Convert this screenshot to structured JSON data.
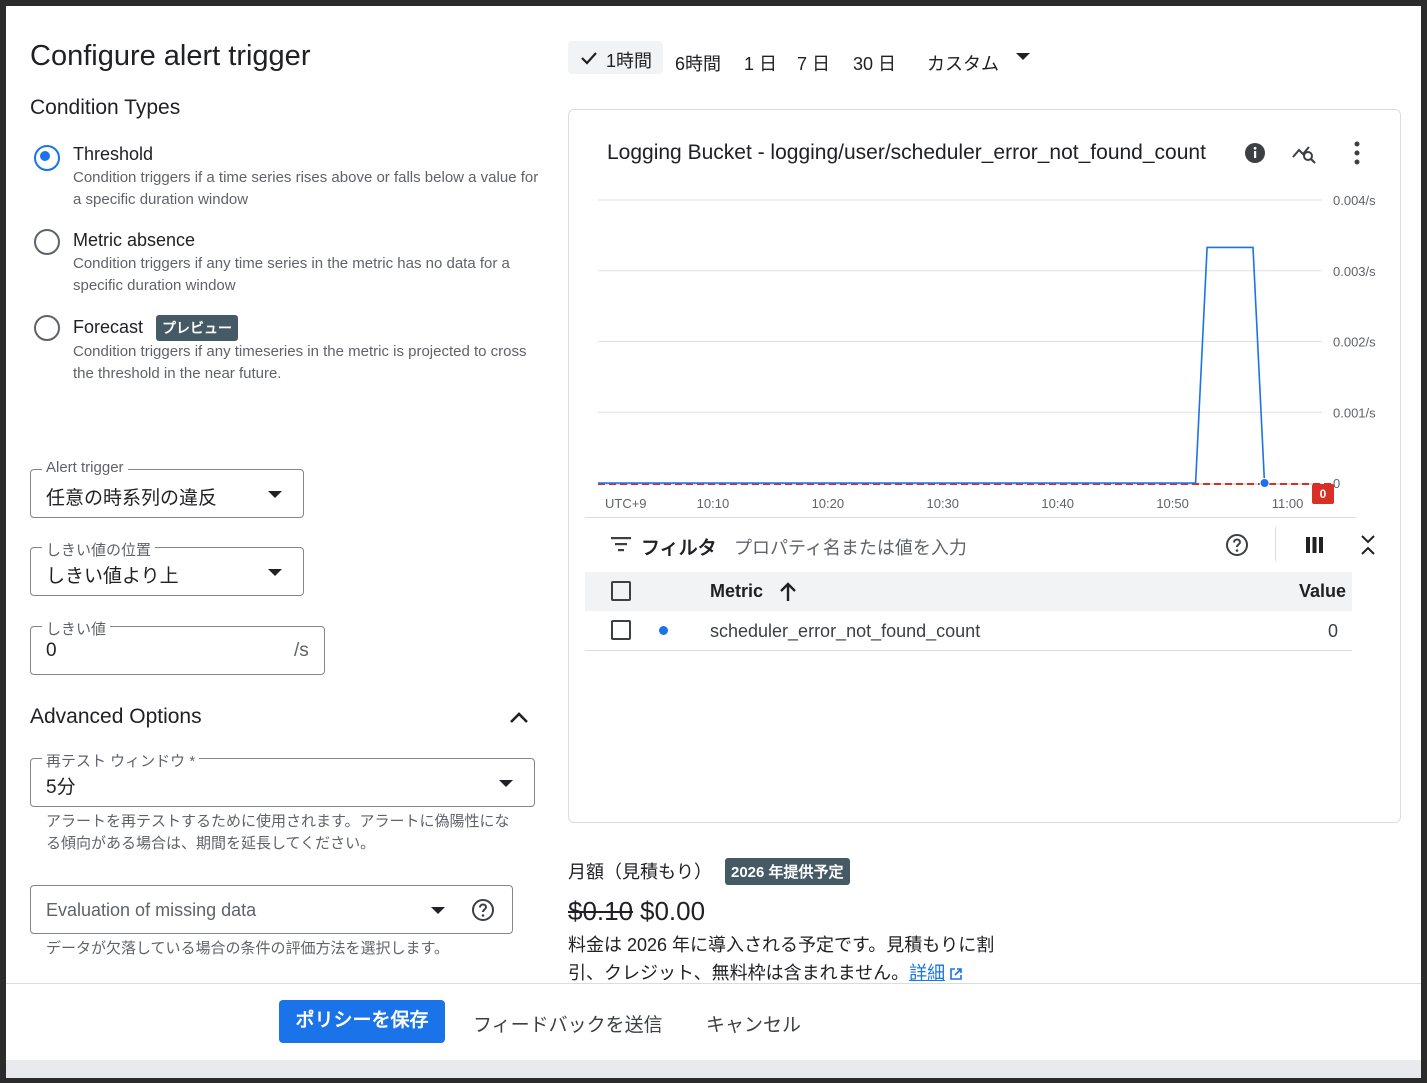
{
  "page": {
    "title": "Configure alert trigger",
    "condition_types_title": "Condition Types"
  },
  "condition_types": [
    {
      "label": "Threshold",
      "description": "Condition triggers if a time series rises above or falls below a value for a specific duration window",
      "selected": true
    },
    {
      "label": "Metric absence",
      "description": "Condition triggers if any time series in the metric has no data for a specific duration window",
      "selected": false
    },
    {
      "label": "Forecast",
      "badge": "プレビュー",
      "description": "Condition triggers if any timeseries in the metric is projected to cross the threshold in the near future.",
      "selected": false
    }
  ],
  "alert_trigger": {
    "label": "Alert trigger",
    "value": "任意の時系列の違反"
  },
  "threshold_position": {
    "label": "しきい値の位置",
    "value": "しきい値より上"
  },
  "threshold_value": {
    "label": "しきい値",
    "value": "0",
    "unit": "/s"
  },
  "advanced": {
    "title": "Advanced Options",
    "retest_window": {
      "label": "再テスト ウィンドウ *",
      "value": "5分",
      "helper": "アラートを再テストするために使用されます。アラートに偽陽性になる傾向がある場合は、期間を延長してください。"
    },
    "missing_data": {
      "placeholder": "Evaluation of missing data",
      "helper": "データが欠落している場合の条件の評価方法を選択します。"
    }
  },
  "time_range": {
    "selected_index": 0,
    "items": [
      "1時間",
      "6時間",
      "1 日",
      "7 日",
      "30 日",
      "カスタム"
    ]
  },
  "chart_panel": {
    "title": "Logging Bucket - logging/user/scheduler_error_not_found_count",
    "filter_label": "フィルタ",
    "filter_placeholder": "プロパティ名または値を入力",
    "table": {
      "header_metric": "Metric",
      "header_value": "Value",
      "rows": [
        {
          "metric": "scheduler_error_not_found_count",
          "value": "0",
          "color": "#1a73e8"
        }
      ]
    },
    "threshold_badge": "0"
  },
  "chart_data": {
    "type": "line",
    "x_label_prefix": "UTC+9",
    "x_ticks": [
      "10:10",
      "10:20",
      "10:30",
      "10:40",
      "10:50",
      "11:00"
    ],
    "y_ticks": [
      "0",
      "0.001/s",
      "0.002/s",
      "0.003/s",
      "0.004/s"
    ],
    "ylim": [
      0,
      0.004
    ],
    "xlim_minutes": [
      0,
      63
    ],
    "series": [
      {
        "color": "#1a73e8",
        "x_minutes": [
          0,
          52,
          53,
          57,
          58
        ],
        "values": [
          0,
          0,
          0.00333,
          0.00333,
          0
        ]
      }
    ],
    "threshold": {
      "value": 0,
      "color": "#d93025",
      "style": "dashed"
    }
  },
  "pricing": {
    "title": "月額（見積もり）",
    "badge": "2026 年提供予定",
    "old_price": "$0.10",
    "new_price": "$0.00",
    "note": "料金は 2026 年に導入される予定です。見積もりに割引、クレジット、無料枠は含まれません。",
    "link": "詳細"
  },
  "footer": {
    "save": "ポリシーを保存",
    "feedback": "フィードバックを送信",
    "cancel": "キャンセル"
  },
  "colors": {
    "accent": "#1a73e8",
    "threshold": "#d93025",
    "badge": "#455a64"
  }
}
